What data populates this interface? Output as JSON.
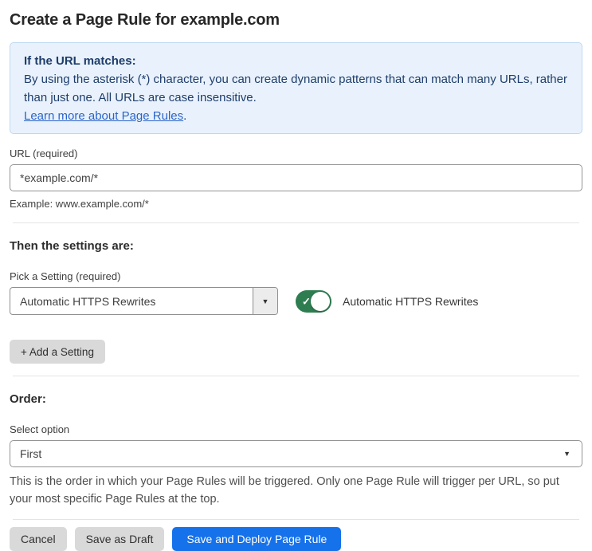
{
  "page": {
    "title": "Create a Page Rule for example.com"
  },
  "info_box": {
    "heading": "If the URL matches:",
    "body": "By using the asterisk (*) character, you can create dynamic patterns that can match many URLs, rather than just one. All URLs are case insensitive.",
    "link_label": "Learn more about Page Rules",
    "link_suffix": "."
  },
  "url_field": {
    "label": "URL (required)",
    "value": "*example.com/*",
    "helper": "Example: www.example.com/*"
  },
  "settings": {
    "heading": "Then the settings are:",
    "picker_label": "Pick a Setting (required)",
    "picker_value": "Automatic HTTPS Rewrites",
    "toggle_state": "on",
    "toggle_label": "Automatic HTTPS Rewrites",
    "add_button_label": "+ Add a Setting"
  },
  "order": {
    "heading": "Order:",
    "select_label": "Select option",
    "select_value": "First",
    "helper": "This is the order in which your Page Rules will be triggered. Only one Page Rule will trigger per URL, so put your most specific Page Rules at the top."
  },
  "footer": {
    "cancel": "Cancel",
    "save_draft": "Save as Draft",
    "save_deploy": "Save and Deploy Page Rule"
  },
  "icons": {
    "dropdown_arrow": "▼",
    "toggle_check": "✓"
  },
  "colors": {
    "primary_blue": "#1672eb",
    "toggle_green": "#2e7d50",
    "info_bg": "#e9f2fc",
    "info_border": "#bdd9f2",
    "info_text": "#1e3d6b",
    "link_blue": "#2b64c8"
  }
}
